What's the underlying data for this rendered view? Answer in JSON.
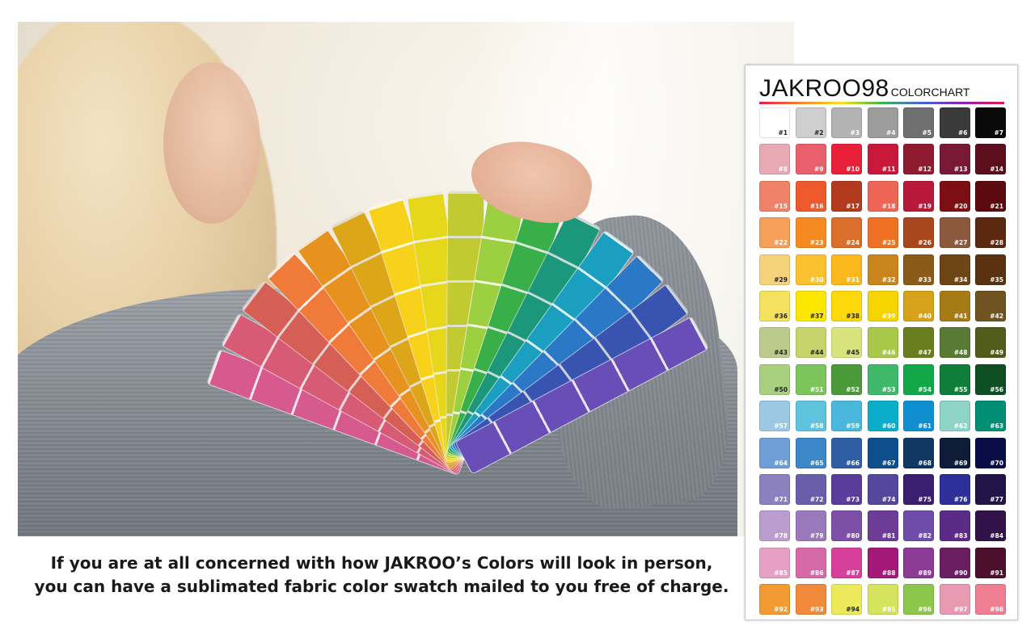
{
  "caption": {
    "line1": "If you are at all concerned with how JAKROO’s Colors will look in person,",
    "line2": "you can have a sublimated fabric color swatch mailed to you free of charge."
  },
  "chart": {
    "title": "JAKROO98",
    "subtitle": "COLORCHART",
    "swatches": [
      {
        "n": "#1",
        "c": "#ffffff",
        "d": true
      },
      {
        "n": "#2",
        "c": "#cfcfcf",
        "d": true
      },
      {
        "n": "#3",
        "c": "#b3b3b3"
      },
      {
        "n": "#4",
        "c": "#9c9c9c"
      },
      {
        "n": "#5",
        "c": "#6f6f6f"
      },
      {
        "n": "#6",
        "c": "#3a3a3a"
      },
      {
        "n": "#7",
        "c": "#0a0a0a"
      },
      {
        "n": "#8",
        "c": "#e8a9b4"
      },
      {
        "n": "#9",
        "c": "#e95f6c"
      },
      {
        "n": "#10",
        "c": "#e8203a"
      },
      {
        "n": "#11",
        "c": "#c8193a"
      },
      {
        "n": "#12",
        "c": "#8e1b30"
      },
      {
        "n": "#13",
        "c": "#7a1838"
      },
      {
        "n": "#14",
        "c": "#5c0e1c"
      },
      {
        "n": "#15",
        "c": "#ef8268"
      },
      {
        "n": "#16",
        "c": "#ee5a2c"
      },
      {
        "n": "#17",
        "c": "#b23b1e"
      },
      {
        "n": "#18",
        "c": "#ee6455"
      },
      {
        "n": "#19",
        "c": "#b8183a"
      },
      {
        "n": "#20",
        "c": "#7c0e14"
      },
      {
        "n": "#21",
        "c": "#5c0a0e"
      },
      {
        "n": "#22",
        "c": "#f5a05a"
      },
      {
        "n": "#23",
        "c": "#f58a23"
      },
      {
        "n": "#24",
        "c": "#d96f2b"
      },
      {
        "n": "#25",
        "c": "#f07124"
      },
      {
        "n": "#26",
        "c": "#a8471c"
      },
      {
        "n": "#27",
        "c": "#8b5a3e"
      },
      {
        "n": "#28",
        "c": "#5b2810"
      },
      {
        "n": "#29",
        "c": "#f6d27a",
        "d": true
      },
      {
        "n": "#30",
        "c": "#fbc12e"
      },
      {
        "n": "#31",
        "c": "#fbb81c"
      },
      {
        "n": "#32",
        "c": "#c9851b"
      },
      {
        "n": "#33",
        "c": "#8a5a1a"
      },
      {
        "n": "#34",
        "c": "#6e4515"
      },
      {
        "n": "#35",
        "c": "#5a3212"
      },
      {
        "n": "#36",
        "c": "#f4e15e",
        "d": true
      },
      {
        "n": "#37",
        "c": "#fde700",
        "d": true
      },
      {
        "n": "#38",
        "c": "#fdd80a",
        "d": true
      },
      {
        "n": "#39",
        "c": "#f6d400"
      },
      {
        "n": "#40",
        "c": "#d6a21a"
      },
      {
        "n": "#41",
        "c": "#a67b16"
      },
      {
        "n": "#42",
        "c": "#6f5320"
      },
      {
        "n": "#43",
        "c": "#bccb8c",
        "d": true
      },
      {
        "n": "#44",
        "c": "#c6d36a",
        "d": true
      },
      {
        "n": "#45",
        "c": "#d9e37e",
        "d": true
      },
      {
        "n": "#46",
        "c": "#a7c848"
      },
      {
        "n": "#47",
        "c": "#6a7d1e"
      },
      {
        "n": "#48",
        "c": "#587a34"
      },
      {
        "n": "#49",
        "c": "#525c1a"
      },
      {
        "n": "#50",
        "c": "#a8d07e",
        "d": true
      },
      {
        "n": "#51",
        "c": "#7cc45c"
      },
      {
        "n": "#52",
        "c": "#4a9a3a"
      },
      {
        "n": "#53",
        "c": "#40b86a"
      },
      {
        "n": "#54",
        "c": "#12a84a"
      },
      {
        "n": "#55",
        "c": "#0e7e3a"
      },
      {
        "n": "#56",
        "c": "#0d4f22"
      },
      {
        "n": "#57",
        "c": "#9cc8e4"
      },
      {
        "n": "#58",
        "c": "#5ec4de"
      },
      {
        "n": "#59",
        "c": "#4ab8dc"
      },
      {
        "n": "#60",
        "c": "#0aaecb"
      },
      {
        "n": "#61",
        "c": "#0f8fd0"
      },
      {
        "n": "#62",
        "c": "#8ed4c6"
      },
      {
        "n": "#63",
        "c": "#008e74"
      },
      {
        "n": "#64",
        "c": "#6f9ed6"
      },
      {
        "n": "#65",
        "c": "#3b87c8"
      },
      {
        "n": "#66",
        "c": "#2f5ea4"
      },
      {
        "n": "#67",
        "c": "#0f4e8c"
      },
      {
        "n": "#68",
        "c": "#123763"
      },
      {
        "n": "#69",
        "c": "#0e1c3a"
      },
      {
        "n": "#70",
        "c": "#0a0e48"
      },
      {
        "n": "#71",
        "c": "#8b80c0"
      },
      {
        "n": "#72",
        "c": "#6a5eaa"
      },
      {
        "n": "#73",
        "c": "#5a3c9a"
      },
      {
        "n": "#74",
        "c": "#55479c"
      },
      {
        "n": "#75",
        "c": "#3a1e70"
      },
      {
        "n": "#76",
        "c": "#2e2f98"
      },
      {
        "n": "#77",
        "c": "#221446"
      },
      {
        "n": "#78",
        "c": "#bb9ccf"
      },
      {
        "n": "#79",
        "c": "#9b78bc"
      },
      {
        "n": "#80",
        "c": "#7e4fa6"
      },
      {
        "n": "#81",
        "c": "#6d3c96"
      },
      {
        "n": "#82",
        "c": "#6e4caa"
      },
      {
        "n": "#83",
        "c": "#5b2a86"
      },
      {
        "n": "#84",
        "c": "#33124a"
      },
      {
        "n": "#85",
        "c": "#e6a0c4"
      },
      {
        "n": "#86",
        "c": "#d66aa8"
      },
      {
        "n": "#87",
        "c": "#d6409a"
      },
      {
        "n": "#88",
        "c": "#a41878"
      },
      {
        "n": "#89",
        "c": "#8b3b94"
      },
      {
        "n": "#90",
        "c": "#6a1e62"
      },
      {
        "n": "#91",
        "c": "#4c0f2c"
      },
      {
        "n": "#92",
        "c": "#f29b32"
      },
      {
        "n": "#93",
        "c": "#f18a3a"
      },
      {
        "n": "#94",
        "c": "#ecea5a",
        "d": true
      },
      {
        "n": "#95",
        "c": "#d6e35c"
      },
      {
        "n": "#96",
        "c": "#8cc64a"
      },
      {
        "n": "#97",
        "c": "#e89ab2"
      },
      {
        "n": "#98",
        "c": "#ee7e92"
      }
    ]
  },
  "fan_colors": [
    "#d65a8e",
    "#e2607a",
    "#ee6a5e",
    "#f07a3a",
    "#f39a20",
    "#f6b81c",
    "#f8d21a",
    "#f3e21c",
    "#d8e036",
    "#9dd040",
    "#3cb84e",
    "#1ea88a",
    "#1a9fc0",
    "#2d7ed0",
    "#3f5cc4",
    "#6a4eb8"
  ]
}
